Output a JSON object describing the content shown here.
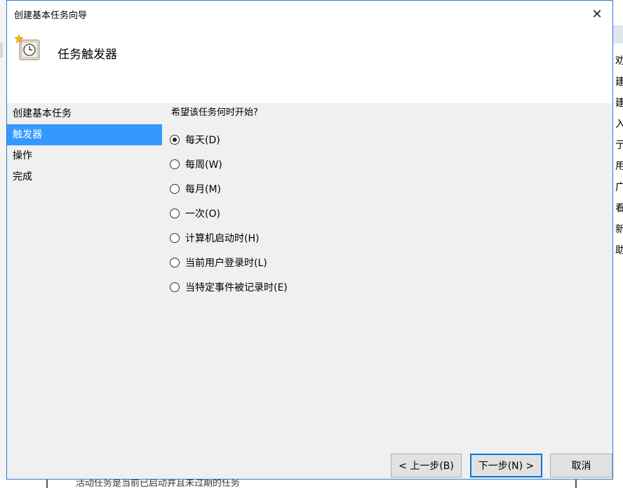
{
  "window": {
    "title": "创建基本任务向导",
    "close_glyph": "✕"
  },
  "header": {
    "title": "任务触发器",
    "icon": "task-clock-icon"
  },
  "nav": {
    "items": [
      {
        "label": "创建基本任务",
        "selected": false
      },
      {
        "label": "触发器",
        "selected": true
      },
      {
        "label": "操作",
        "selected": false
      },
      {
        "label": "完成",
        "selected": false
      }
    ]
  },
  "content": {
    "question": "希望该任务何时开始?",
    "options": [
      {
        "label": "每天(D)",
        "checked": true
      },
      {
        "label": "每周(W)",
        "checked": false
      },
      {
        "label": "每月(M)",
        "checked": false
      },
      {
        "label": "一次(O)",
        "checked": false
      },
      {
        "label": "计算机启动时(H)",
        "checked": false
      },
      {
        "label": "当前用户登录时(L)",
        "checked": false
      },
      {
        "label": "当特定事件被记录时(E)",
        "checked": false
      }
    ]
  },
  "buttons": {
    "back": "< 上一步(B)",
    "next": "下一步(N) >",
    "cancel": "取消"
  },
  "background": {
    "right_chars": [
      "劝",
      "建",
      "建",
      "入",
      "亍",
      "用",
      "广",
      "看",
      "新",
      "助"
    ],
    "bottom_text": "活动任务是当前已启动并且未过期的任务"
  },
  "colors": {
    "accent": "#3399ff",
    "window_border": "#2b79d6",
    "dialog_bg": "#f0f0f0"
  }
}
